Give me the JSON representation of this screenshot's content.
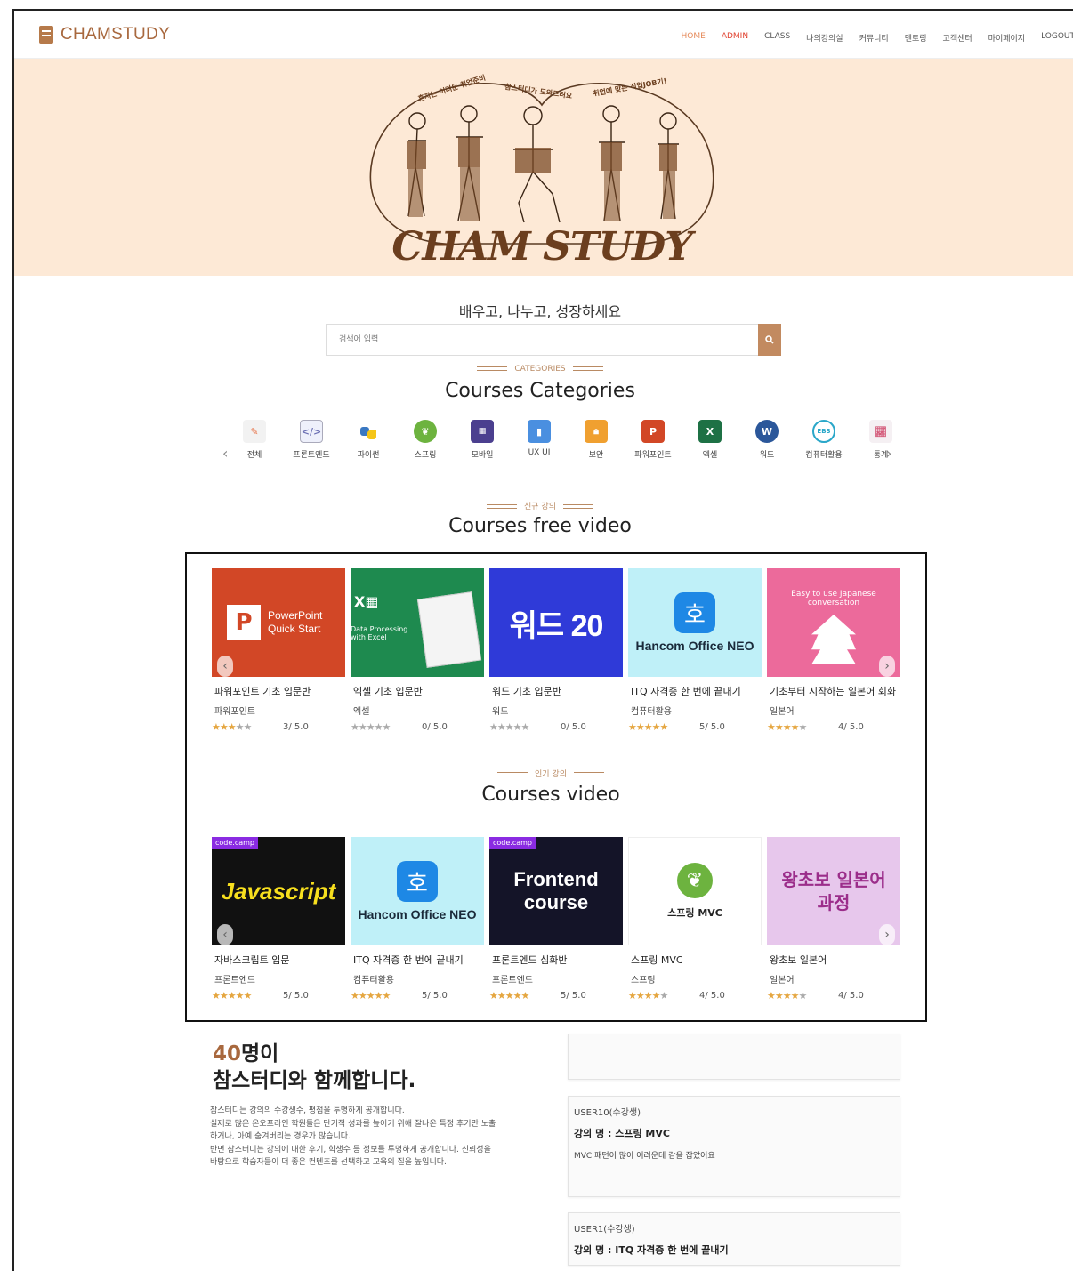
{
  "header": {
    "logo": "CHAMSTUDY",
    "nav": [
      "HOME",
      "ADMIN",
      "CLASS",
      "나의강의실",
      "커뮤니티",
      "멘토링",
      "고객센터",
      "마이페이지",
      "LOGOUT"
    ]
  },
  "hero": {
    "badges": [
      "혼자는 어려운 취업준비",
      "참스터디가 도와드려요",
      "취업에 맞는 직업JOB기!"
    ],
    "title": "CHAM STUDY"
  },
  "search": {
    "tagline": "배우고, 나누고, 성장하세요",
    "placeholder": "검색어 입력"
  },
  "categories": {
    "eyebrow": "CATEGORIES",
    "title": "Courses Categories",
    "items": [
      {
        "label": "전체",
        "icon": "pencil-icon",
        "color": "#e8754a"
      },
      {
        "label": "프론트엔드",
        "icon": "code-icon",
        "color": "#6b6fb3"
      },
      {
        "label": "파이썬",
        "icon": "python-icon",
        "color": "#3a78c2"
      },
      {
        "label": "스프링",
        "icon": "spring-icon",
        "color": "#6db33f"
      },
      {
        "label": "모바일",
        "icon": "mobile-icon",
        "color": "#4b3f8f"
      },
      {
        "label": "UX UI",
        "icon": "layout-icon",
        "color": "#4a8fe0"
      },
      {
        "label": "보안",
        "icon": "lock-icon",
        "color": "#f0a030"
      },
      {
        "label": "파워포인트",
        "icon": "powerpoint-icon",
        "color": "#d24726"
      },
      {
        "label": "엑셀",
        "icon": "excel-icon",
        "color": "#1e7145"
      },
      {
        "label": "워드",
        "icon": "word-icon",
        "color": "#2b579a"
      },
      {
        "label": "컴퓨터활용",
        "icon": "ebs-icon",
        "color": "#2aa7c9"
      },
      {
        "label": "통계",
        "icon": "chart-icon",
        "color": "#d45a7a"
      }
    ]
  },
  "free": {
    "eyebrow": "신규 강의",
    "title": "Courses free video",
    "cards": [
      {
        "title": "파워포인트 기초 입문반",
        "category": "파워포인트",
        "rating": 3,
        "score": "3/ 5.0",
        "thumb": "PowerPoint Quick Start",
        "bg": "#d24726"
      },
      {
        "title": "엑셀 기초 입문반",
        "category": "엑셀",
        "rating": 0,
        "score": "0/ 5.0",
        "thumb": "Data Processing with Excel",
        "bg": "#1e8a4f"
      },
      {
        "title": "워드 기초 입문반",
        "category": "워드",
        "rating": 0,
        "score": "0/ 5.0",
        "thumb": "워드 20",
        "bg": "#2f3ad8"
      },
      {
        "title": "ITQ 자격증 한 번에 끝내기",
        "category": "컴퓨터활용",
        "rating": 5,
        "score": "5/ 5.0",
        "thumb": "Hancom Office NEO",
        "bg": "#bff0f8"
      },
      {
        "title": "기초부터 시작하는 일본어 회화",
        "category": "일본어",
        "rating": 4,
        "score": "4/ 5.0",
        "thumb": "Easy to use Japanese conversation",
        "bg": "#ec6a9b"
      }
    ]
  },
  "popular": {
    "eyebrow": "인기 강의",
    "title": "Courses video",
    "cards": [
      {
        "title": "자바스크립트 입문",
        "category": "프론트엔드",
        "rating": 5,
        "score": "5/ 5.0",
        "thumb": "Javascript",
        "bg": "#111111"
      },
      {
        "title": "ITQ 자격증 한 번에 끝내기",
        "category": "컴퓨터활용",
        "rating": 5,
        "score": "5/ 5.0",
        "thumb": "Hancom Office NEO",
        "bg": "#bff0f8"
      },
      {
        "title": "프론트엔드 심화반",
        "category": "프론트엔드",
        "rating": 5,
        "score": "5/ 5.0",
        "thumb": "Frontend course",
        "bg": "#141428"
      },
      {
        "title": "스프링 MVC",
        "category": "스프링",
        "rating": 4,
        "score": "4/ 5.0",
        "thumb": "스프링 MVC",
        "bg": "#ffffff"
      },
      {
        "title": "왕초보 일본어",
        "category": "일본어",
        "rating": 4,
        "score": "4/ 5.0",
        "thumb": "왕초보 일본어 과정",
        "bg": "#e7c7ec"
      }
    ]
  },
  "community": {
    "count": "40",
    "count_suffix": "명이",
    "headline": "참스터디와 함께합니다.",
    "desc": [
      "참스터디는 강의의 수강생수, 평점을 투명하게 공개합니다.",
      "실제로 많은 온오프라인 학원들은 단기적 성과를 높이기 위해 잘나온 특정 후기만 노출",
      "하거나, 아예 숨겨버리는 경우가 많습니다.",
      "반면 참스터디는 강의에 대한 후기, 학생수 등 정보를 투명하게 공개합니다. 신뢰성을",
      "바탕으로 학습자들이 더 좋은 컨텐츠를 선택하고 교육의 질을 높입니다."
    ],
    "reviews": [
      {
        "user": "USER10(수강생)",
        "course": "강의 명 : 스프링 MVC",
        "body": "MVC 패턴이 많이 어려운데 감을 잡았어요"
      },
      {
        "user": "USER1(수강생)",
        "course": "강의 명 : ITQ 자격증 한 번에 끝내기",
        "body": ""
      }
    ]
  },
  "colors": {
    "brand": "#a8683e",
    "accent": "#c28a60",
    "hero_bg": "#fde9d6",
    "star": "#e5a640"
  }
}
